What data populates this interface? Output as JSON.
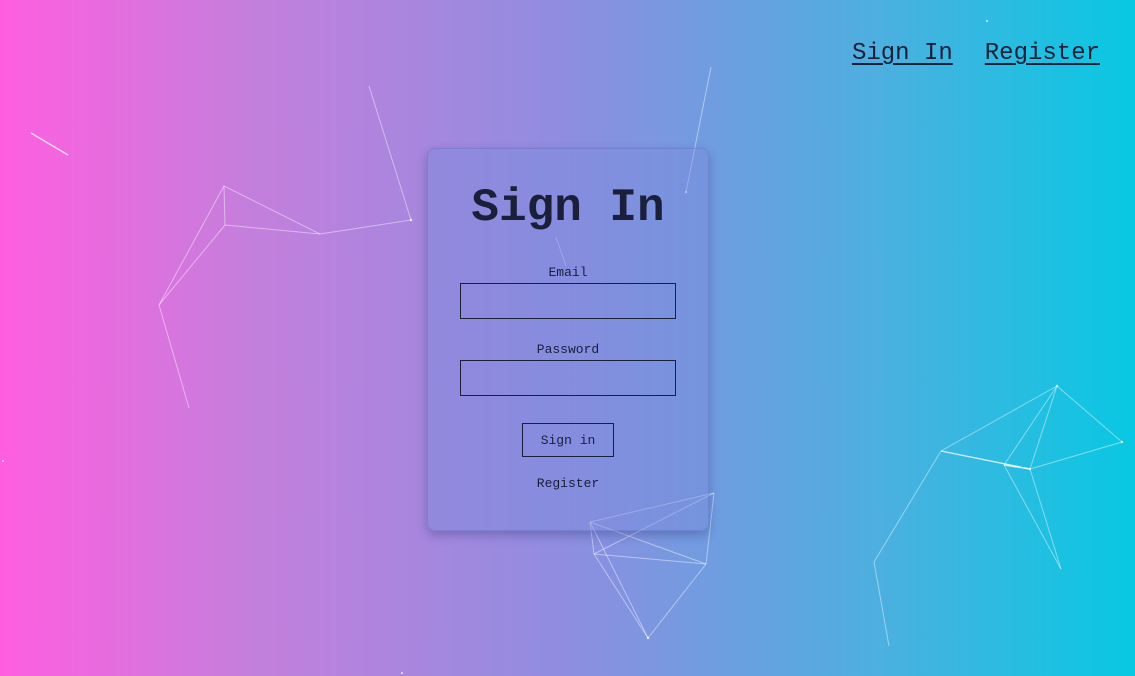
{
  "nav": {
    "sign_in_label": "Sign In",
    "register_label": "Register"
  },
  "form": {
    "title": "Sign In",
    "email_label": "Email",
    "email_value": "",
    "password_label": "Password",
    "password_value": "",
    "submit_label": "Sign in",
    "register_link_label": "Register"
  },
  "colors": {
    "gradient_start": "#ff5ee0",
    "gradient_end": "#08c8e2",
    "text": "#1a1f3a"
  }
}
